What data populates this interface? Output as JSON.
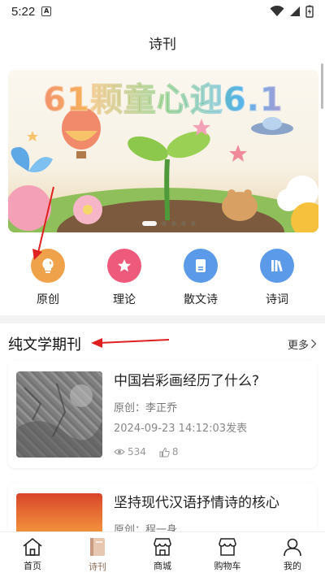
{
  "status": {
    "time": "5:22",
    "notif_letter": "A"
  },
  "header": {
    "title": "诗刊"
  },
  "banner": {
    "text": "61颗童心迎6.1"
  },
  "categories": [
    {
      "label": "原创",
      "icon": "lightbulb-icon",
      "color": "#f0a24a"
    },
    {
      "label": "理论",
      "icon": "star-icon",
      "color": "#ee5a7c"
    },
    {
      "label": "散文诗",
      "icon": "document-icon",
      "color": "#5a9ae8"
    },
    {
      "label": "诗词",
      "icon": "books-icon",
      "color": "#5a9ae8"
    }
  ],
  "section": {
    "title": "纯文学期刊",
    "more": "更多"
  },
  "articles": [
    {
      "title": "中国岩彩画经历了什么?",
      "author": "原创：李正乔",
      "date": "2024-09-23 14:12:03发表",
      "views": "534",
      "likes": "8"
    },
    {
      "title": "坚持现代汉语抒情诗的核心",
      "author": "原创：程一身"
    }
  ],
  "nav": [
    {
      "label": "首页",
      "icon": "home-icon"
    },
    {
      "label": "诗刊",
      "icon": "book-icon"
    },
    {
      "label": "商城",
      "icon": "shop-icon"
    },
    {
      "label": "购物车",
      "icon": "cart-store-icon"
    },
    {
      "label": "我的",
      "icon": "user-icon"
    }
  ],
  "colors": {
    "accent": "#8a6a55",
    "annotation": "#e02020"
  }
}
